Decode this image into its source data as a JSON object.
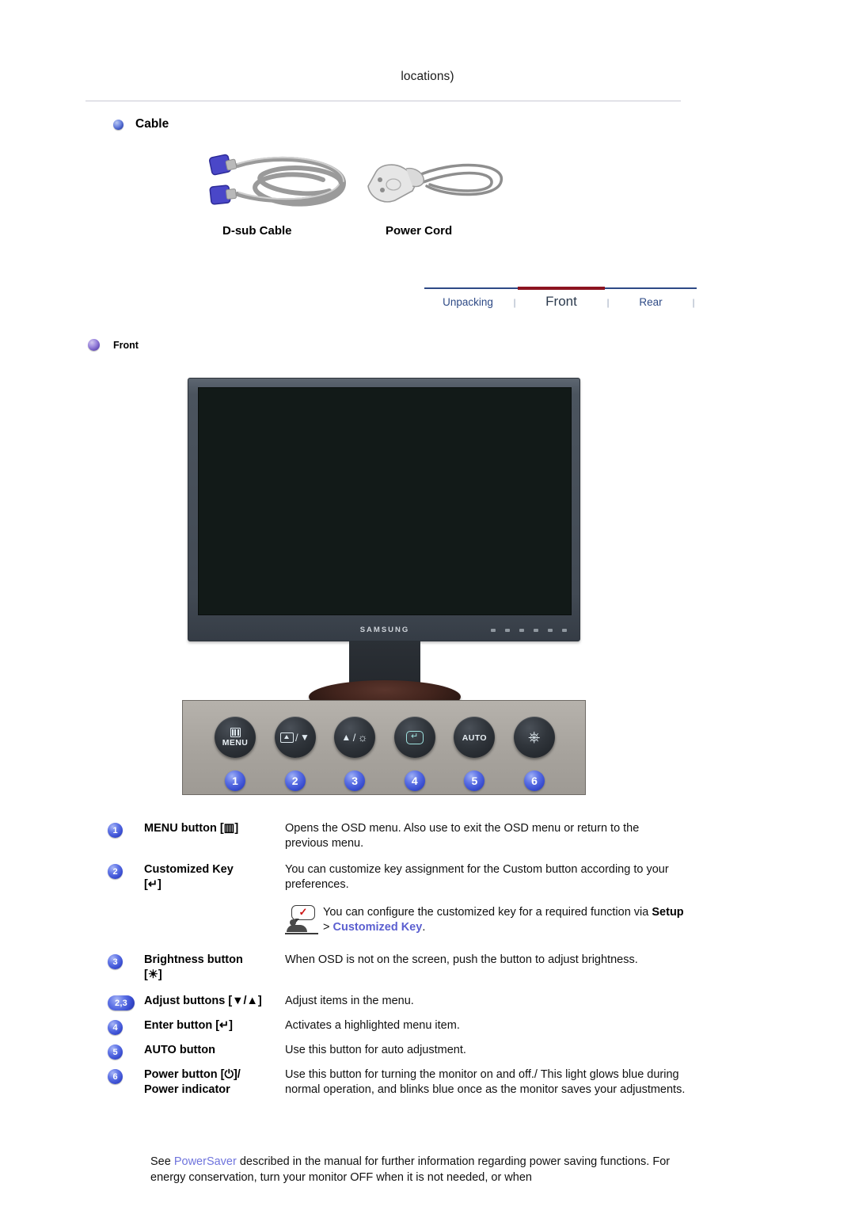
{
  "header": {
    "continued_text": "locations)"
  },
  "sections": {
    "cable": {
      "title": "Cable",
      "bullet_icon": "blue-sphere-bullet-icon",
      "items": [
        {
          "caption": "D-sub Cable",
          "image": "dsub-cable-image"
        },
        {
          "caption": "Power Cord",
          "image": "power-cord-image"
        }
      ]
    },
    "front": {
      "title": "Front",
      "bullet_icon": "violet-sphere-bullet-icon"
    }
  },
  "tabbar": {
    "active_color": "#8c1420",
    "link_color": "#2e4a86",
    "separator": "|",
    "tabs": [
      {
        "label": "Unpacking",
        "active": false
      },
      {
        "label": "Front",
        "active": true
      },
      {
        "label": "Rear",
        "active": false
      }
    ]
  },
  "monitor": {
    "brand": "SAMSUNG",
    "screen_state": "off",
    "bezel_key_count": 6
  },
  "control_panel": {
    "buttons": [
      {
        "number": "1",
        "glyph": "menu-bars-icon",
        "caption": "MENU"
      },
      {
        "number": "2",
        "glyph": "source-down-icon",
        "caption": ""
      },
      {
        "number": "3",
        "glyph": "up-brightness-icon",
        "caption": ""
      },
      {
        "number": "4",
        "glyph": "enter-icon",
        "caption": ""
      },
      {
        "number": "5",
        "glyph": "",
        "caption": "AUTO"
      },
      {
        "number": "6",
        "glyph": "power-icon",
        "caption": ""
      }
    ]
  },
  "descriptions": [
    {
      "badge": "1",
      "label": "MENU button [▥]",
      "text": "Opens the OSD menu. Also use to exit the OSD menu or return to the previous menu."
    },
    {
      "badge": "2",
      "label": "Customized Key",
      "label2": "[↵]",
      "text": "You can customize key assignment for the Custom button according to your preferences."
    },
    {
      "badge": "3",
      "label": "Brightness button",
      "label2": "[☀]",
      "text": "When OSD is not on the screen, push the button to adjust brightness."
    },
    {
      "badge": "2,3",
      "label": "Adjust buttons [▼/▲]",
      "text": "Adjust items in the menu."
    },
    {
      "badge": "4",
      "label": "Enter button [↵]",
      "text": "Activates a highlighted menu item."
    },
    {
      "badge": "5",
      "label": "AUTO button",
      "text": "Use this button for auto adjustment."
    },
    {
      "badge": "6",
      "label": "Power button [⏻]/",
      "label2": "Power indicator",
      "text": "Use this button for turning the monitor on and off./ This light glows blue during normal operation, and blinks blue once as the monitor saves your adjustments."
    }
  ],
  "note": {
    "icon": "person-with-check-bubble-icon",
    "text_before": "You can configure the customized key for a required function via ",
    "keyword_bold": "Setup",
    "separator": " > ",
    "keyword_link": "Customized Key",
    "text_after": "."
  },
  "footer": {
    "text_before": "See ",
    "link": "PowerSaver",
    "text_after": " described in the manual for further information regarding power saving functions. For energy conservation, turn your monitor OFF when it is not needed, or when"
  }
}
